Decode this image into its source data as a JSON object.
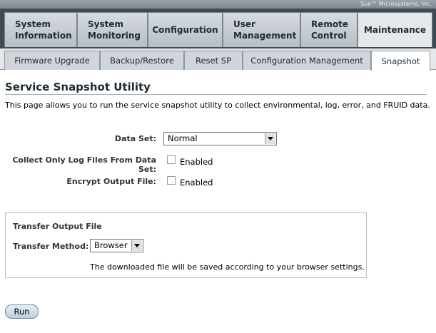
{
  "brand": "Sun™ Microsystems, Inc.",
  "main_tabs": [
    {
      "line1": "System",
      "line2": "Information"
    },
    {
      "line1": "System",
      "line2": "Monitoring"
    },
    {
      "line1": "Configuration",
      "line2": ""
    },
    {
      "line1": "User",
      "line2": "Management"
    },
    {
      "line1": "Remote",
      "line2": "Control"
    },
    {
      "line1": "Maintenance",
      "line2": ""
    }
  ],
  "active_main_tab": "Maintenance",
  "sub_tabs": [
    "Firmware Upgrade",
    "Backup/Restore",
    "Reset SP",
    "Configuration Management",
    "Snapshot"
  ],
  "active_sub_tab": "Snapshot",
  "page": {
    "title": "Service Snapshot Utility",
    "description": "This page allows you to run the service snapshot utility to collect environmental, log, error, and FRUID data."
  },
  "form": {
    "data_set_label": "Data Set:",
    "data_set_value": "Normal",
    "collect_logs_label": "Collect Only Log Files From Data Set:",
    "collect_logs_option": "Enabled",
    "collect_logs_checked": false,
    "encrypt_label": "Encrypt Output File:",
    "encrypt_option": "Enabled",
    "encrypt_checked": false
  },
  "transfer": {
    "title": "Transfer Output File",
    "method_label": "Transfer Method:",
    "method_value": "Browser",
    "note": "The downloaded file will be saved according to your browser settings."
  },
  "run_label": "Run"
}
